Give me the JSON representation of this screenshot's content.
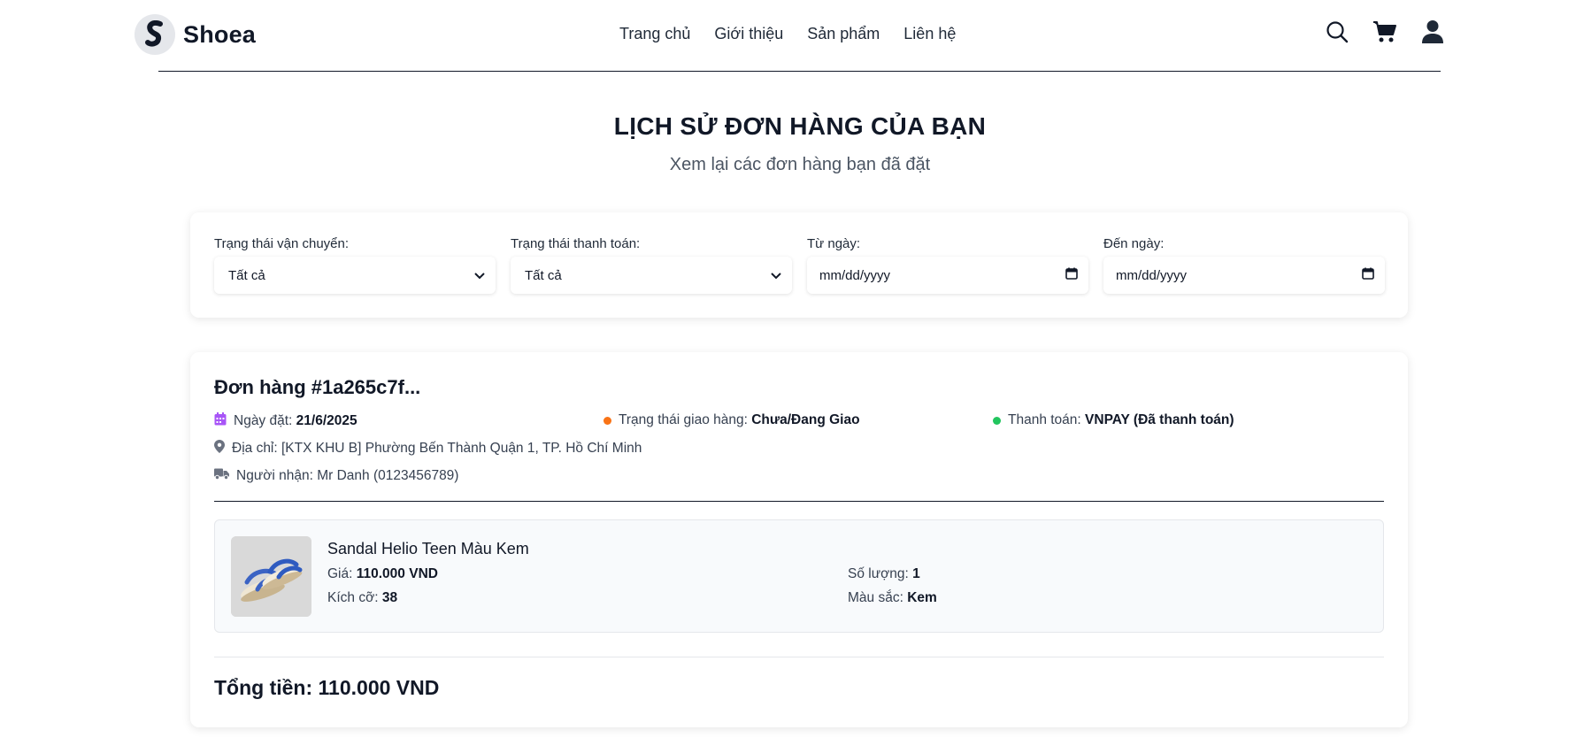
{
  "brand": {
    "name": "Shoea",
    "logo_letter": "S"
  },
  "nav": {
    "items": [
      {
        "label": "Trang chủ"
      },
      {
        "label": "Giới thiệu"
      },
      {
        "label": "Sản phẩm"
      },
      {
        "label": "Liên hệ"
      }
    ]
  },
  "header_icons": [
    "search-icon",
    "cart-icon",
    "user-icon"
  ],
  "page": {
    "title": "LỊCH SỬ ĐƠN HÀNG CỦA BẠN",
    "subtitle": "Xem lại các đơn hàng bạn đã đặt"
  },
  "filters": {
    "shipping_status": {
      "label": "Trạng thái vận chuyển:",
      "value": "Tất cả"
    },
    "payment_status": {
      "label": "Trạng thái thanh toán:",
      "value": "Tất cả"
    },
    "from_date": {
      "label": "Từ ngày:",
      "placeholder": "mm/dd/yyyy"
    },
    "to_date": {
      "label": "Đến ngày:",
      "placeholder": "mm/dd/yyyy"
    }
  },
  "order": {
    "title": "Đơn hàng #1a265c7f...",
    "order_date_label": "Ngày đặt:",
    "order_date": "21/6/2025",
    "shipping_label": "Trạng thái giao hàng:",
    "shipping_value": "Chưa/Đang Giao",
    "payment_label": "Thanh toán:",
    "payment_value": "VNPAY (Đã thanh toán)",
    "address": "Địa chỉ: [KTX KHU B] Phường Bến Thành Quận 1, TP. Hồ Chí Minh",
    "recipient": "Người nhận: Mr Danh (0123456789)",
    "items": [
      {
        "name": "Sandal Helio Teen Màu Kem",
        "price_label": "Giá:",
        "price": "110.000 VND",
        "size_label": "Kích cỡ:",
        "size": "38",
        "quantity_label": "Số lượng:",
        "quantity": "1",
        "color_label": "Màu sắc:",
        "color": "Kem"
      }
    ],
    "total": "Tổng tiền: 110.000 VND"
  },
  "colors": {
    "text_dark": "#111827",
    "calendar_icon": "#a855f7",
    "shipping_dot": "#f97316",
    "payment_dot": "#22c55e",
    "muted_icon": "#6b7280"
  }
}
